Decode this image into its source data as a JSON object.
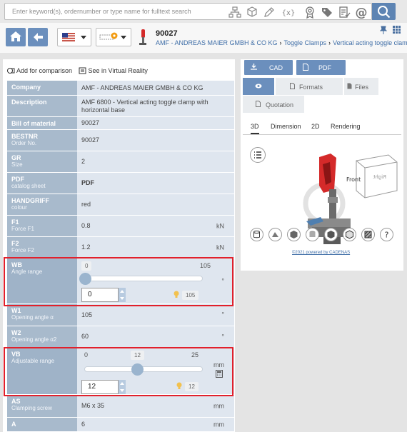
{
  "search": {
    "placeholder": "Enter keyword(s), ordernumber or type name for fulltext search"
  },
  "header": {
    "product_number": "90027",
    "breadcrumb": [
      "AMF - ANDREAS MAIER GMBH & CO KG",
      "Toggle Clamps",
      "Vertical acting toggle clamps"
    ]
  },
  "actions": {
    "compare": "Add for comparison",
    "vr": "See in Virtual Reality"
  },
  "table": [
    {
      "key": "Company",
      "sub": "",
      "value": "AMF - ANDREAS MAIER GMBH & CO KG",
      "unit": ""
    },
    {
      "key": "Description",
      "sub": "",
      "value": "AMF 6800 - Vertical acting toggle clamp with horizontal base",
      "unit": ""
    },
    {
      "key": "Bill of material",
      "sub": "",
      "value": "90027",
      "unit": ""
    },
    {
      "key": "BESTNR",
      "sub": "Order No.",
      "value": "90027",
      "unit": ""
    },
    {
      "key": "GR",
      "sub": "Size",
      "value": "2",
      "unit": ""
    },
    {
      "key": "PDF",
      "sub": "catalog sheet",
      "value": "PDF",
      "unit": ""
    },
    {
      "key": "HANDGRIFF",
      "sub": "colour",
      "value": "red",
      "unit": ""
    },
    {
      "key": "F1",
      "sub": "Force F1",
      "value": "0.8",
      "unit": "kN"
    },
    {
      "key": "F2",
      "sub": "Force F2",
      "value": "1.2",
      "unit": "kN"
    },
    {
      "key": "WB",
      "sub": "Angle range",
      "min": "0",
      "max": "105",
      "input": "0",
      "default": "105",
      "unit": "°"
    },
    {
      "key": "W1",
      "sub": "Opening angle α",
      "value": "105",
      "unit": "°"
    },
    {
      "key": "W2",
      "sub": "Opening angle α2",
      "value": "60",
      "unit": "°"
    },
    {
      "key": "VB",
      "sub": "Adjustable range",
      "min": "0",
      "mid": "12",
      "max": "25",
      "input": "12",
      "default": "12",
      "unit": "mm"
    },
    {
      "key": "AS",
      "sub": "Clamping screw",
      "value": "M6 x 35",
      "unit": "mm"
    },
    {
      "key": "A",
      "sub": "",
      "value": "6",
      "unit": "mm"
    }
  ],
  "right": {
    "cad": "CAD",
    "pdf": "PDF",
    "tabs": {
      "formats": "Formats",
      "files": "Files",
      "quotation": "Quotation"
    },
    "subtabs": [
      "3D",
      "Dimension",
      "2D",
      "Rendering"
    ],
    "cube_front": "Front",
    "cube_right": "Right",
    "credit": "©2021 powered by CADENAS"
  },
  "colors": {
    "accent": "#6b8fbd",
    "key_bg": "#a8bacc",
    "value_bg": "#dfe6ef",
    "highlight": "#e2202b",
    "handle": "#d42a2a"
  },
  "icons": [
    "home-icon",
    "back-arrow-icon",
    "us-flag-icon",
    "key-icon",
    "pin-icon",
    "grid-icon",
    "magnifier-icon"
  ]
}
